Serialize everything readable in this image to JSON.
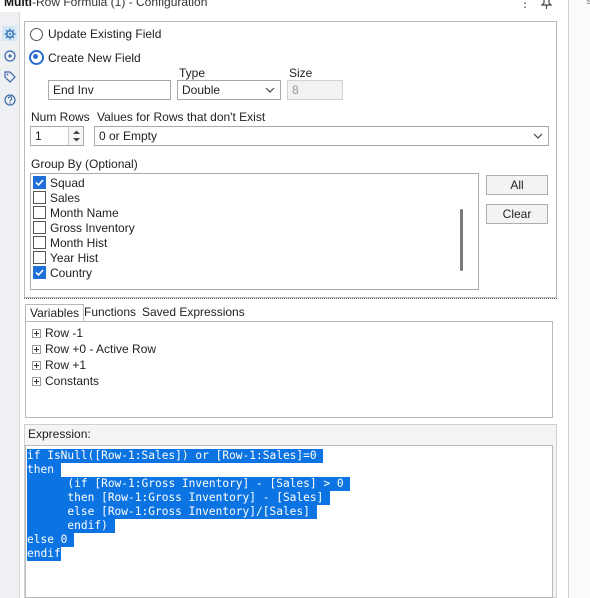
{
  "window": {
    "title_prefix": "Multi",
    "title_rest": "-Row Formula (1) - Configuration",
    "menu_glyph": "⋮",
    "pin_glyph": "📌",
    "gutter_text": "\"s"
  },
  "side_icons": [
    "gear-icon",
    "target-icon",
    "tag-icon",
    "help-icon"
  ],
  "field_mode": {
    "update_label": "Update Existing Field",
    "create_label": "Create New  Field",
    "selected": "create"
  },
  "new_field": {
    "name_value": "End Inv",
    "type_label": "Type",
    "type_value": "Double",
    "size_label": "Size",
    "size_value": "8"
  },
  "rows": {
    "num_rows_label": "Num Rows",
    "num_rows_value": "1",
    "missing_label": "Values for Rows that don't Exist",
    "missing_value": "0 or Empty"
  },
  "group_by": {
    "label": "Group By (Optional)",
    "items": [
      {
        "label": "Squad",
        "checked": true
      },
      {
        "label": "Sales",
        "checked": false
      },
      {
        "label": "Month Name",
        "checked": false
      },
      {
        "label": "Gross Inventory",
        "checked": false
      },
      {
        "label": "Month Hist",
        "checked": false
      },
      {
        "label": "Year Hist",
        "checked": false
      },
      {
        "label": "Country",
        "checked": true
      }
    ],
    "all_button": "All",
    "clear_button": "Clear"
  },
  "tabs": [
    "Variables",
    "Functions",
    "Saved Expressions"
  ],
  "variables": [
    "Row -1",
    "Row +0 - Active Row",
    "Row +1",
    "Constants"
  ],
  "expression": {
    "label": "Expression:",
    "lines": [
      "if IsNull([Row-1:Sales]) or [Row-1:Sales]=0 ",
      "then ",
      "      (if [Row-1:Gross Inventory] - [Sales] > 0 ",
      "      then [Row-1:Gross Inventory] - [Sales] ",
      "      else [Row-1:Gross Inventory]/[Sales] ",
      "      endif) ",
      "else 0 ",
      "endif"
    ]
  }
}
